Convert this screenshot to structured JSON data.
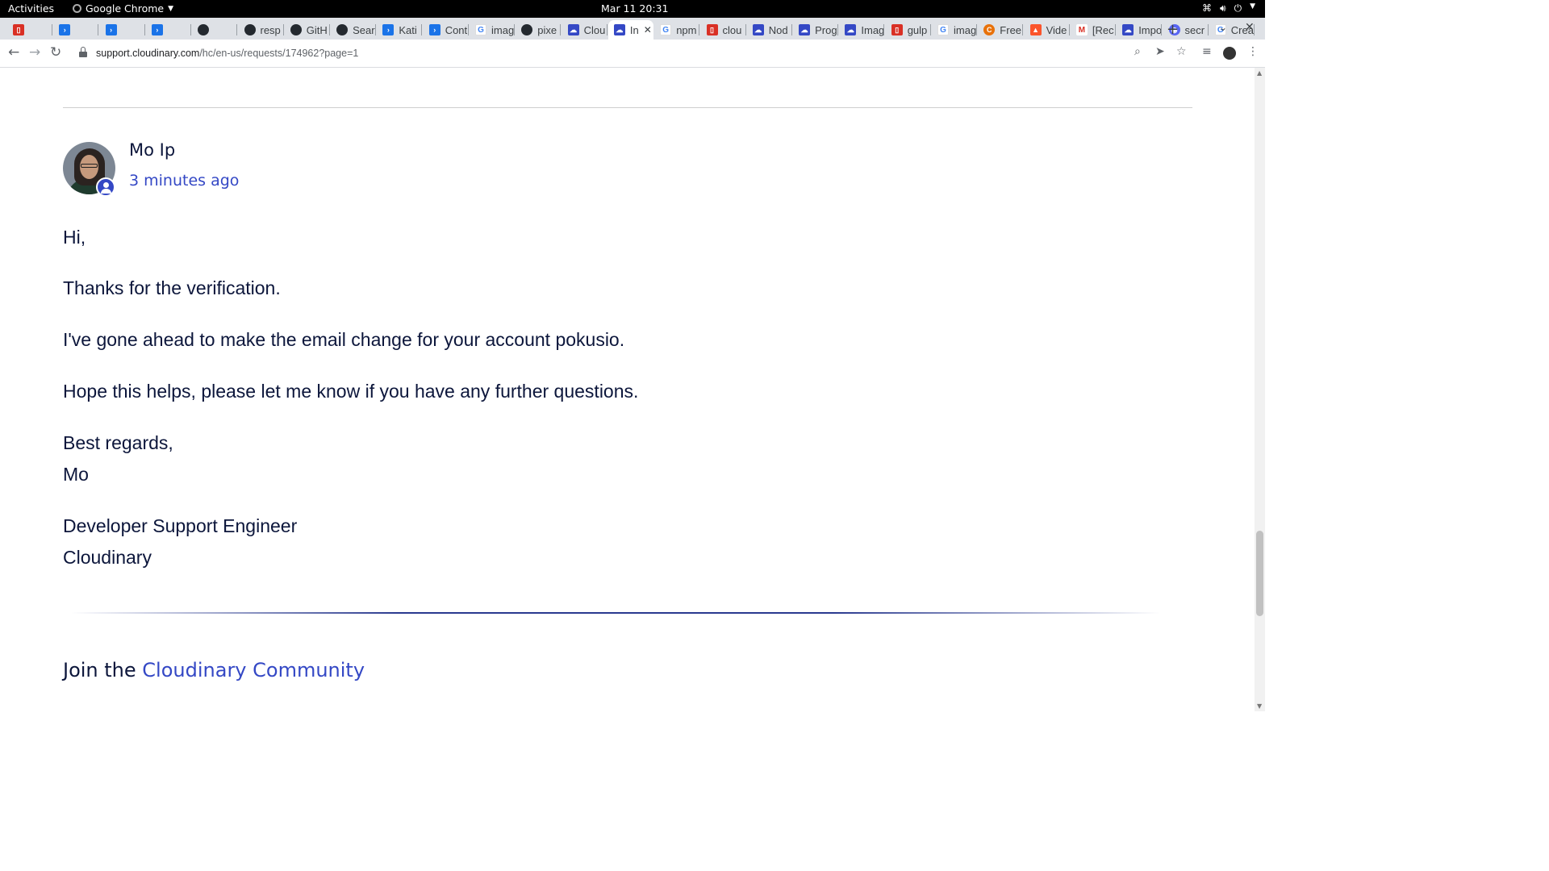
{
  "system_bar": {
    "activities": "Activities",
    "app_name": "Google Chrome",
    "clock": "Mar 11  20:31"
  },
  "browser": {
    "tabs": [
      {
        "label": "",
        "icon": "red-square-icon"
      },
      {
        "label": "",
        "icon": "terminal-icon"
      },
      {
        "label": "",
        "icon": "terminal-icon"
      },
      {
        "label": "",
        "icon": "terminal-icon"
      },
      {
        "label": "",
        "icon": "github-icon"
      },
      {
        "label": "resp",
        "icon": "github-icon"
      },
      {
        "label": "GitH",
        "icon": "github-icon"
      },
      {
        "label": "Sear",
        "icon": "github-icon"
      },
      {
        "label": "Kati",
        "icon": "terminal-icon"
      },
      {
        "label": "Cont",
        "icon": "terminal-icon"
      },
      {
        "label": "imag",
        "icon": "google-icon"
      },
      {
        "label": "pixe",
        "icon": "github-icon"
      },
      {
        "label": "Clou",
        "icon": "cloudinary-icon"
      },
      {
        "label": "In",
        "icon": "cloudinary-icon",
        "active": true
      },
      {
        "label": "npm",
        "icon": "google-icon"
      },
      {
        "label": "clou",
        "icon": "red-square-icon"
      },
      {
        "label": "Nod",
        "icon": "cloudinary-icon"
      },
      {
        "label": "Prog",
        "icon": "cloudinary-icon"
      },
      {
        "label": "Imag",
        "icon": "cloudinary-icon"
      },
      {
        "label": "gulp",
        "icon": "red-square-icon"
      },
      {
        "label": "imag",
        "icon": "google-icon"
      },
      {
        "label": "Free",
        "icon": "orange-circle-icon"
      },
      {
        "label": "Vide",
        "icon": "brave-icon"
      },
      {
        "label": "[Rec",
        "icon": "gmail-icon"
      },
      {
        "label": "Impo",
        "icon": "cloudinary-icon"
      },
      {
        "label": "secr",
        "icon": "discord-icon"
      },
      {
        "label": "Crea",
        "icon": "google-icon"
      }
    ],
    "url_host": "support.cloudinary.com",
    "url_path": "/hc/en-us/requests/174962?page=1"
  },
  "comment": {
    "author": "Mo Ip",
    "time": "3 minutes ago",
    "paragraphs": [
      "Hi,",
      "Thanks for the verification.",
      "I've gone ahead to make the email change for your account pokusio.",
      "Hope this helps, please let me know if you have any further questions.",
      "Best regards,",
      "Mo",
      "Developer Support Engineer",
      "Cloudinary"
    ]
  },
  "footer": {
    "join_prefix": "Join the ",
    "join_link": "Cloudinary Community"
  },
  "colors": {
    "brand_blue": "#3448c5",
    "text_navy": "#0c163b"
  }
}
